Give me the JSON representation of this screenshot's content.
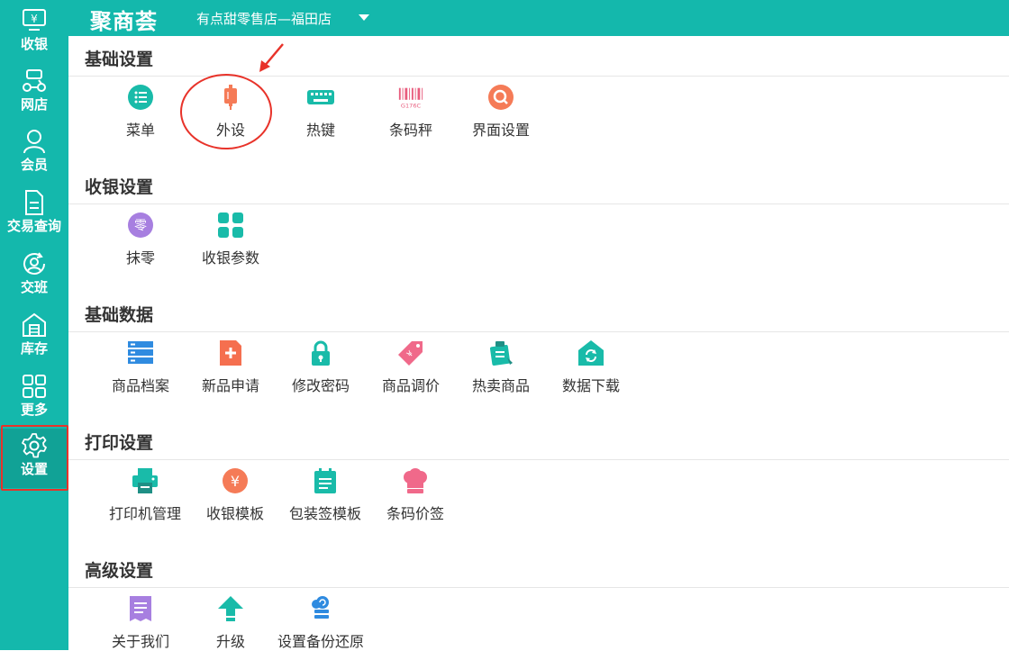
{
  "header": {
    "logo": "聚商荟",
    "store": "有点甜零售店—福田店"
  },
  "sidebar": {
    "items": [
      {
        "label": "收银"
      },
      {
        "label": "网店"
      },
      {
        "label": "会员"
      },
      {
        "label": "交易查询"
      },
      {
        "label": "交班"
      },
      {
        "label": "库存"
      },
      {
        "label": "更多"
      },
      {
        "label": "设置"
      }
    ],
    "active": "设置"
  },
  "sections": [
    {
      "title": "基础设置",
      "items": [
        {
          "label": "菜单",
          "icon": "menu-list-icon"
        },
        {
          "label": "外设",
          "icon": "usb-device-icon"
        },
        {
          "label": "热键",
          "icon": "keyboard-icon"
        },
        {
          "label": "条码秤",
          "icon": "barcode-icon",
          "icon_text": "G176C"
        },
        {
          "label": "界面设置",
          "icon": "search-circle-icon"
        }
      ]
    },
    {
      "title": "收银设置",
      "items": [
        {
          "label": "抹零",
          "icon": "zero-icon",
          "icon_text": "零"
        },
        {
          "label": "收银参数",
          "icon": "grid-icon"
        }
      ]
    },
    {
      "title": "基础数据",
      "items": [
        {
          "label": "商品档案",
          "icon": "server-icon"
        },
        {
          "label": "新品申请",
          "icon": "new-file-icon"
        },
        {
          "label": "修改密码",
          "icon": "lock-icon"
        },
        {
          "label": "商品调价",
          "icon": "price-tag-icon"
        },
        {
          "label": "热卖商品",
          "icon": "hot-goods-icon"
        },
        {
          "label": "数据下载",
          "icon": "download-house-icon"
        }
      ]
    },
    {
      "title": "打印设置",
      "items": [
        {
          "label": "打印机管理",
          "icon": "printer-icon"
        },
        {
          "label": "收银模板",
          "icon": "yen-icon",
          "icon_text": "¥"
        },
        {
          "label": "包装签模板",
          "icon": "calendar-icon"
        },
        {
          "label": "条码价签",
          "icon": "chef-hat-icon"
        }
      ]
    },
    {
      "title": "高级设置",
      "items": [
        {
          "label": "关于我们",
          "icon": "about-doc-icon"
        },
        {
          "label": "升级",
          "icon": "upgrade-arrow-icon"
        },
        {
          "label": "设置备份还原",
          "icon": "cloud-backup-icon"
        }
      ]
    }
  ],
  "colors": {
    "brand": "#14b8ac",
    "annotation": "#e8332a"
  }
}
